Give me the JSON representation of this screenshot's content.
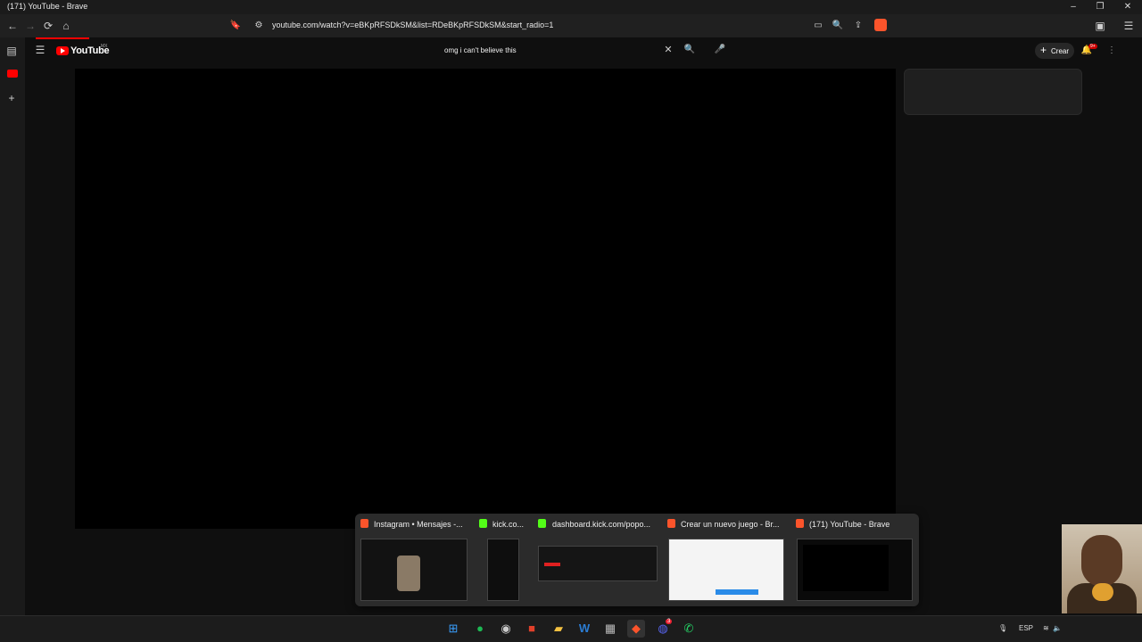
{
  "window": {
    "title": "(171) YouTube - Brave",
    "minimize": "–",
    "maximize": "❐",
    "close": "✕"
  },
  "toolbar": {
    "back": "←",
    "forward": "→",
    "reload": "⟳",
    "home": "⌂",
    "bookmark": "🔖",
    "site_info": "⚙",
    "url": "youtube.com/watch?v=eBKpRFSDkSM&list=RDeBKpRFSDkSM&start_radio=1",
    "right_icons": [
      "▭",
      "🔍",
      "⇪"
    ],
    "sidebar_toggle": "▣",
    "menu": "☰"
  },
  "youtube": {
    "wordmark": "YouTube",
    "country_code": "MX",
    "hamburger": "☰",
    "search_query": "omg i can't believe this",
    "clear_glyph": "✕",
    "search_glyph": "🔍",
    "mic_glyph": "🎤",
    "create_label": "Crear",
    "create_plus": "+",
    "notification_badge": "9+",
    "bell": "🔔",
    "more": "⋮"
  },
  "sidebar": {
    "panel_icon": "▤",
    "add_icon": "+"
  },
  "taskbar_popup": {
    "windows": [
      {
        "title": "Instagram • Mensajes -...",
        "icon_color": "#fb542b"
      },
      {
        "title": "kick.co...",
        "icon_color": "#53fc18"
      },
      {
        "title": "dashboard.kick.com/popo...",
        "icon_color": "#53fc18"
      },
      {
        "title": "Crear un nuevo juego - Br...",
        "icon_color": "#fb542b"
      },
      {
        "title": "(171) YouTube - Brave",
        "icon_color": "#fb542b"
      }
    ]
  },
  "taskbar": {
    "apps": [
      "⊞",
      "●",
      "◉",
      "■",
      "▰",
      "W",
      "▦",
      "◆",
      "◍",
      "✆"
    ],
    "discord_badge": "3",
    "tray": {
      "mic": "🎙",
      "language": "ESP",
      "wifi": "≋",
      "volume": "🔈"
    }
  }
}
